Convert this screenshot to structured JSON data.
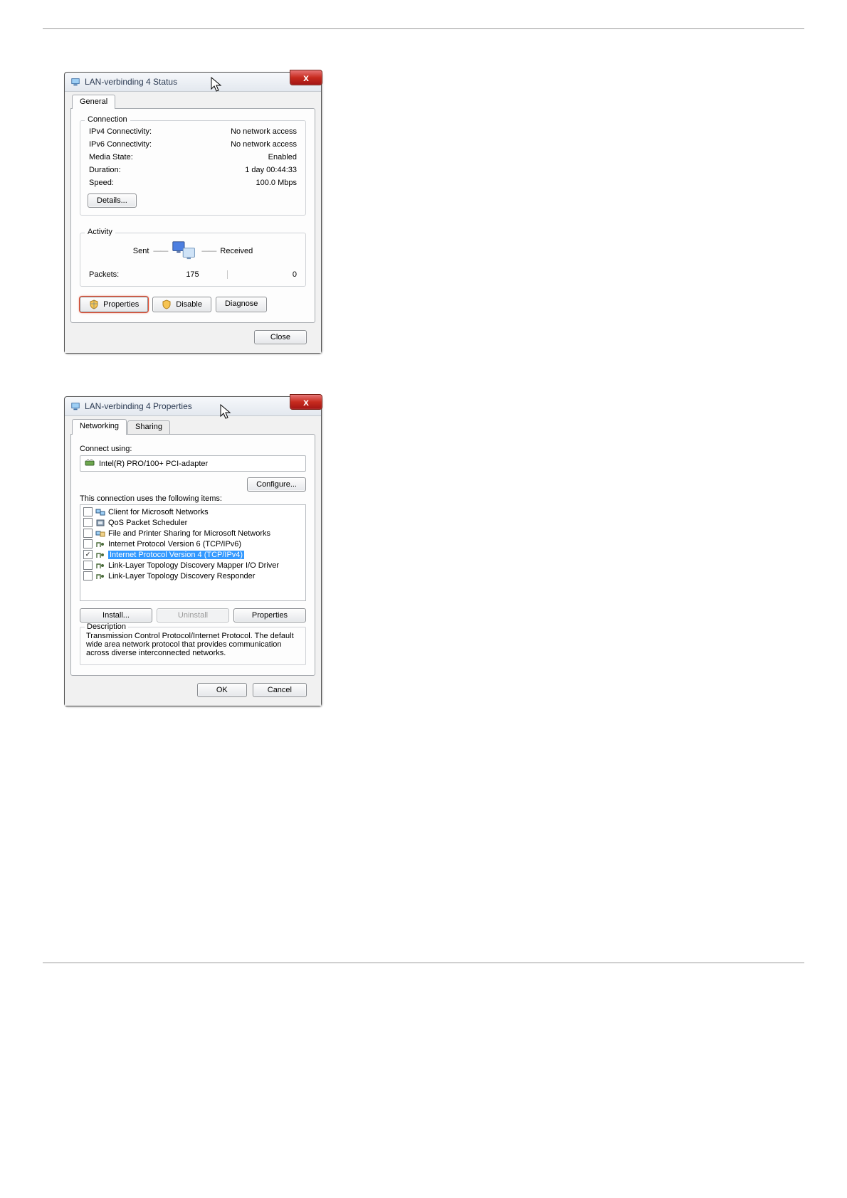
{
  "status_dialog": {
    "title": "LAN-verbinding 4 Status",
    "close_x": "x",
    "tab_general": "General",
    "group_connection": "Connection",
    "rows": {
      "ipv4_label": "IPv4 Connectivity:",
      "ipv4_value": "No network access",
      "ipv6_label": "IPv6 Connectivity:",
      "ipv6_value": "No network access",
      "media_label": "Media State:",
      "media_value": "Enabled",
      "duration_label": "Duration:",
      "duration_value": "1 day 00:44:33",
      "speed_label": "Speed:",
      "speed_value": "100.0 Mbps"
    },
    "details_btn": "Details...",
    "group_activity": "Activity",
    "sent_label": "Sent",
    "received_label": "Received",
    "packets_label": "Packets:",
    "packets_sent": "175",
    "packets_received": "0",
    "properties_btn": "Properties",
    "disable_btn": "Disable",
    "diagnose_btn": "Diagnose",
    "close_btn": "Close"
  },
  "props_dialog": {
    "title": "LAN-verbinding 4 Properties",
    "close_x": "x",
    "tab_networking": "Networking",
    "tab_sharing": "Sharing",
    "connect_using_label": "Connect using:",
    "adapter_name": "Intel(R) PRO/100+ PCI-adapter",
    "configure_btn": "Configure...",
    "items_label": "This connection uses the following items:",
    "items": [
      {
        "checked": false,
        "label": "Client for Microsoft Networks"
      },
      {
        "checked": false,
        "label": "QoS Packet Scheduler"
      },
      {
        "checked": false,
        "label": "File and Printer Sharing for Microsoft Networks"
      },
      {
        "checked": false,
        "label": "Internet Protocol Version 6 (TCP/IPv6)"
      },
      {
        "checked": true,
        "label": "Internet Protocol Version 4 (TCP/IPv4)",
        "selected": true
      },
      {
        "checked": false,
        "label": "Link-Layer Topology Discovery Mapper I/O Driver"
      },
      {
        "checked": false,
        "label": "Link-Layer Topology Discovery Responder"
      }
    ],
    "install_btn": "Install...",
    "uninstall_btn": "Uninstall",
    "item_properties_btn": "Properties",
    "description_label": "Description",
    "description_text": "Transmission Control Protocol/Internet Protocol. The default wide area network protocol that provides communication across diverse interconnected networks.",
    "ok_btn": "OK",
    "cancel_btn": "Cancel"
  }
}
